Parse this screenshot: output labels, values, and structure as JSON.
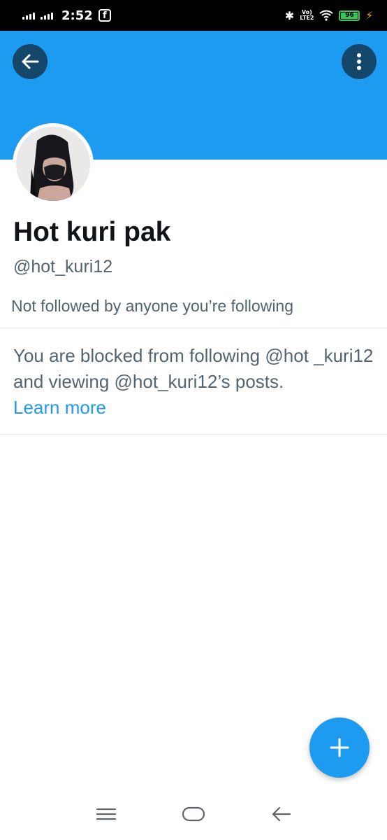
{
  "status_bar": {
    "time": "2:52",
    "app_notification_icon": "facebook-icon",
    "network_label": "VoLTE2",
    "battery_percent": "96",
    "battery_level": 0.96,
    "charging": true
  },
  "header": {
    "banner_color": "#1d9bf0",
    "back_icon": "arrow-left-icon",
    "more_icon": "more-vertical-icon"
  },
  "profile": {
    "display_name": "Hot kuri pak",
    "handle": "@hot_kuri12",
    "followers_note": "Not followed by anyone you’re following"
  },
  "blocked_notice": {
    "message": "You are blocked from following @hot _kuri12 and viewing @hot_kuri12’s posts.",
    "link_label": "Learn more"
  },
  "fab": {
    "icon": "plus-icon"
  },
  "nav_bar": {
    "icons": [
      "menu-icon",
      "home-icon",
      "back-icon"
    ]
  },
  "colors": {
    "accent": "#1d9bf0",
    "text_primary": "#0f1419",
    "text_secondary": "#536471"
  }
}
